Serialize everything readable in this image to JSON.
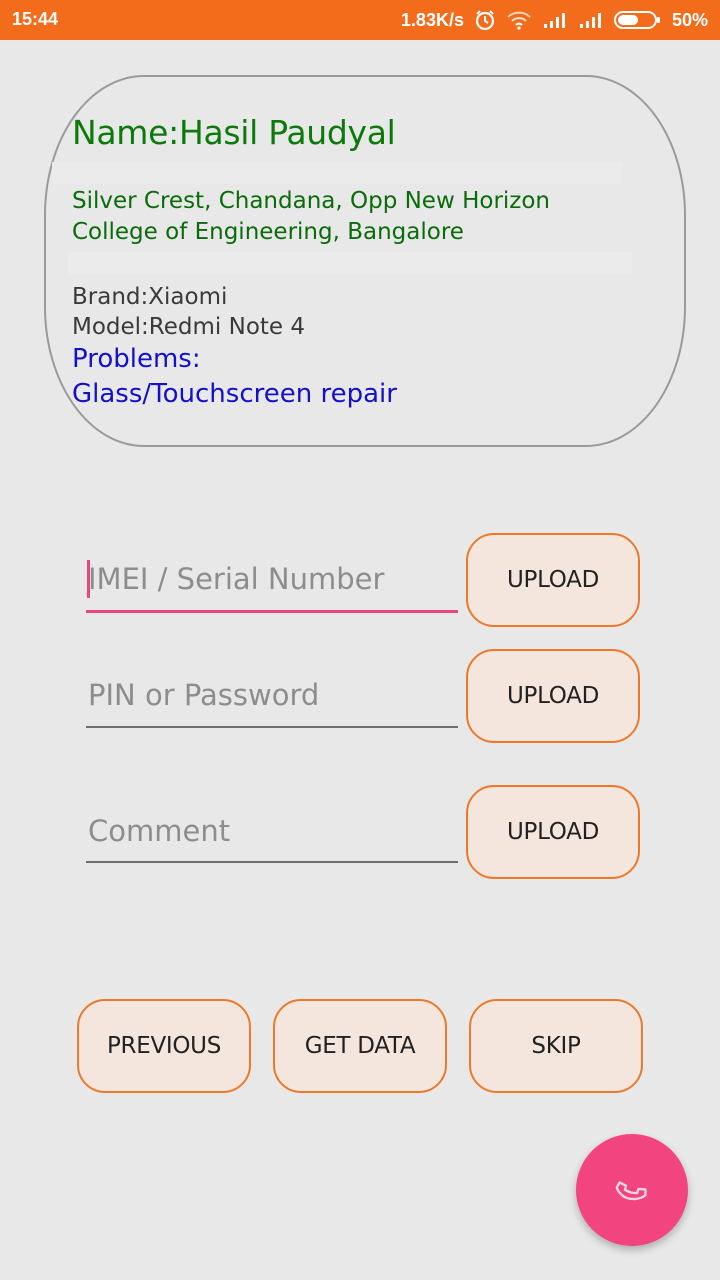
{
  "status_bar": {
    "time": "15:44",
    "speed": "1.83K/s",
    "battery": "50%",
    "icons": [
      "alarm-icon",
      "wifi-icon",
      "signal-icon",
      "signal-icon",
      "battery-icon"
    ]
  },
  "customer": {
    "name": "Name:Hasil Paudyal",
    "address_line1": "Silver Crest, Chandana, Opp New Horizon",
    "address_line2": "College of Engineering, Bangalore",
    "brand": "Brand:Xiaomi",
    "model": "Model:Redmi Note 4",
    "problems_label": "Problems:",
    "problem": "Glass/Touchscreen repair"
  },
  "form": {
    "imei": {
      "value": "",
      "placeholder": "IMEI / Serial Number",
      "upload_label": "UPLOAD"
    },
    "pin": {
      "value": "",
      "placeholder": "PIN or Password",
      "upload_label": "UPLOAD"
    },
    "comment": {
      "value": "",
      "placeholder": "Comment",
      "upload_label": "UPLOAD"
    }
  },
  "actions": {
    "previous": "PREVIOUS",
    "get_data": "GET DATA",
    "skip": "SKIP"
  },
  "fab": {
    "icon": "phone-icon"
  },
  "colors": {
    "status_bar": "#f26c1c",
    "name": "#0b7a0b",
    "problems": "#1410c8",
    "accent": "#e8487a",
    "button_border": "#ec7a2a",
    "button_fill": "#f4e5dd",
    "fab": "#f2447e"
  }
}
